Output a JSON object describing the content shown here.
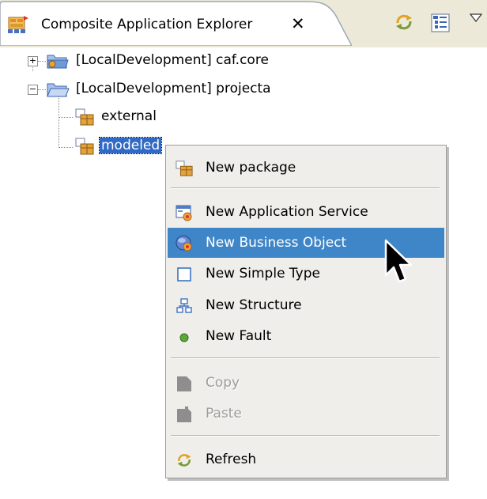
{
  "view": {
    "title": "Composite Application Explorer",
    "close_glyph": "✕",
    "icons": [
      "composite-app-icon",
      "sync-icon",
      "layout-icon",
      "view-menu-icon"
    ]
  },
  "tree": {
    "items": [
      {
        "label": "[LocalDevelopment] caf.core",
        "expander": "+",
        "icon": "project-folder-icon"
      },
      {
        "label": "[LocalDevelopment] projecta",
        "expander": "−",
        "icon": "project-folder-open-icon"
      },
      {
        "label": "external",
        "icon": "package-icon"
      },
      {
        "label": "modeled",
        "icon": "package-icon",
        "selected": true
      }
    ]
  },
  "context_menu": {
    "items": [
      {
        "label": "New package",
        "icon": "package-icon",
        "enabled": true
      },
      {
        "label": "New Application Service",
        "icon": "application-service-icon",
        "enabled": true
      },
      {
        "label": "New Business Object",
        "icon": "business-object-icon",
        "enabled": true,
        "highlighted": true
      },
      {
        "label": "New Simple Type",
        "icon": "simple-type-icon",
        "enabled": true
      },
      {
        "label": "New Structure",
        "icon": "structure-icon",
        "enabled": true
      },
      {
        "label": "New Fault",
        "icon": "fault-icon",
        "enabled": true
      },
      {
        "label": "Copy",
        "icon": "copy-icon",
        "enabled": false
      },
      {
        "label": "Paste",
        "icon": "paste-icon",
        "enabled": false
      },
      {
        "label": "Refresh",
        "icon": "refresh-icon",
        "enabled": true
      }
    ]
  },
  "colors": {
    "header_bg": "#ece9d8",
    "menu_bg": "#efeeea",
    "highlight": "#3f86c8",
    "selection": "#316ac5",
    "disabled_text": "#9d9d9d"
  }
}
